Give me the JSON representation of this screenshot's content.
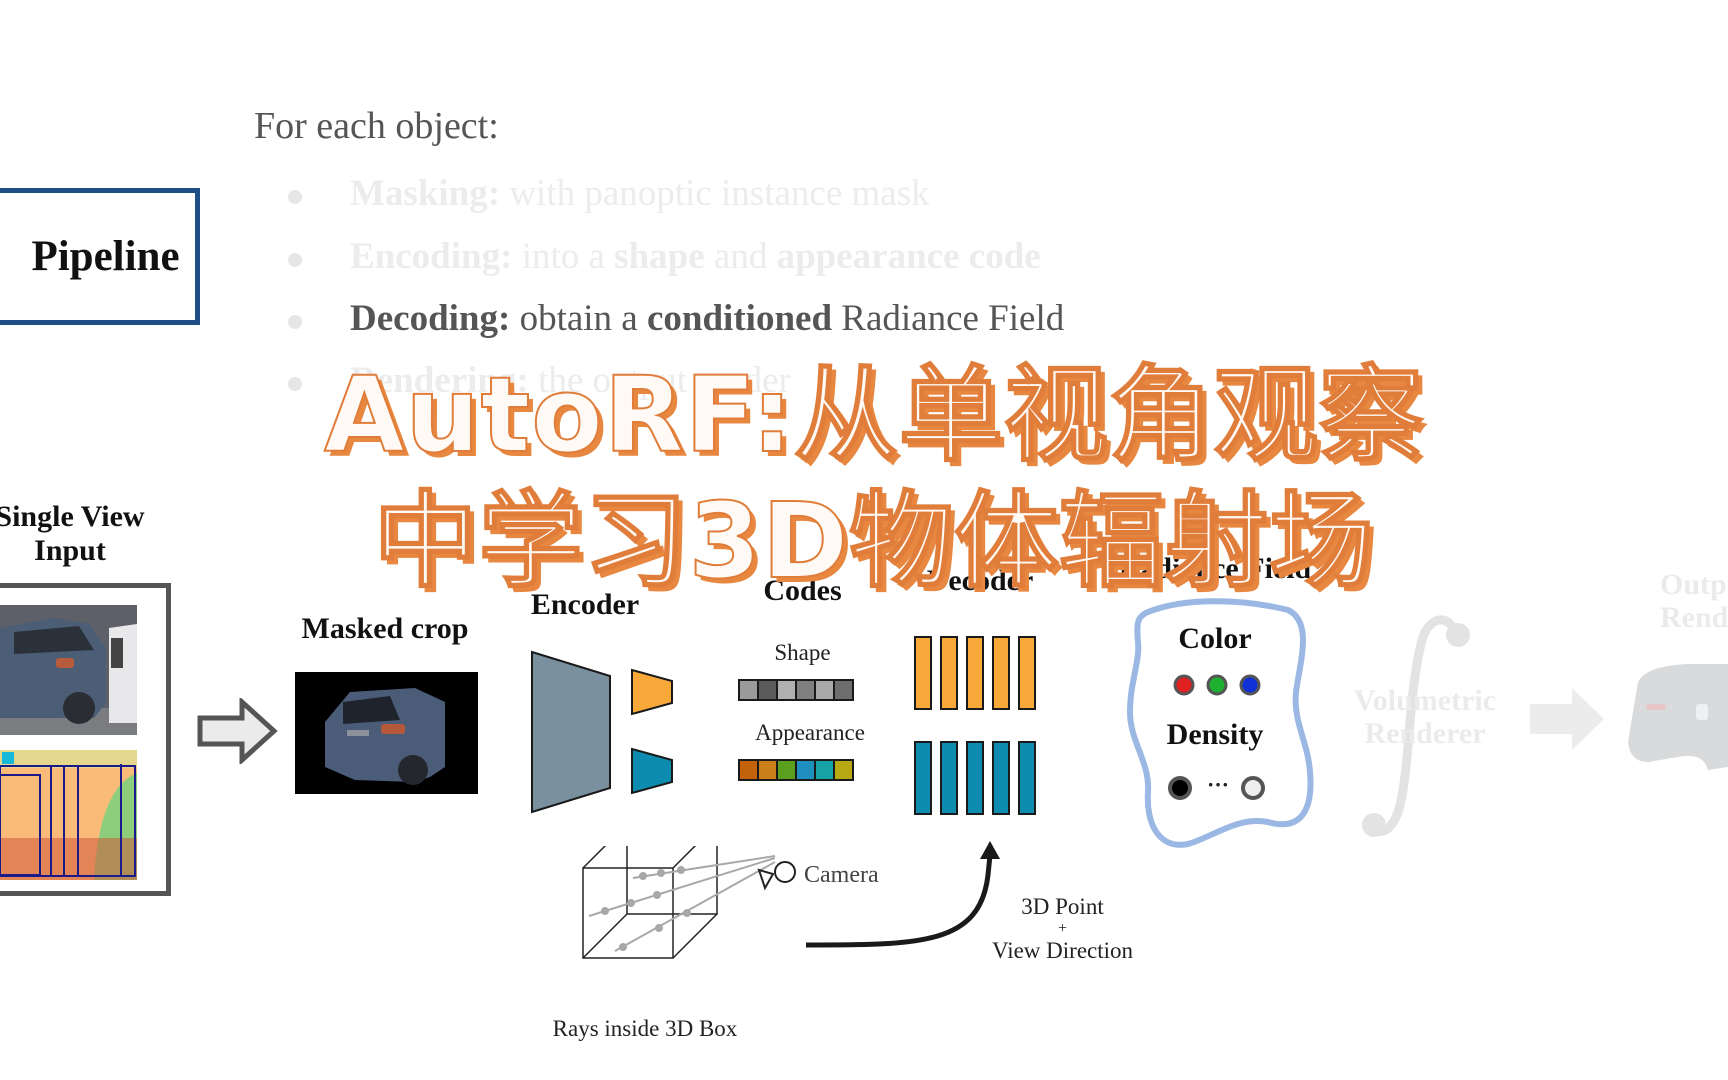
{
  "slide": {
    "intro": "For each object:",
    "section_label": "Pipeline",
    "bullets": [
      {
        "term": "Masking:",
        "rest": " with panoptic instance mask",
        "state": "faded"
      },
      {
        "term": "Encoding:",
        "parts": [
          " into a ",
          "shape",
          " and ",
          "appearance code"
        ],
        "state": "faded"
      },
      {
        "term": "Decoding:",
        "parts": [
          " obtain a ",
          "conditioned",
          " Radiance Field"
        ],
        "state": "active"
      },
      {
        "term": "Rendering:",
        "rest": " the output render",
        "state": "faded"
      }
    ]
  },
  "overlay_title": {
    "line1": "AutoRF:从单视角观察",
    "line2": "中学习3D物体辐射场",
    "color": "#e07d3a"
  },
  "diagram": {
    "input_label_line1": "Single View",
    "input_label_line2": "Input",
    "masked_crop_label": "Masked crop",
    "encoder_label": "Encoder",
    "codes_label": "Codes",
    "shape_label": "Shape",
    "appearance_label": "Appearance",
    "decoder_label": "Decoder",
    "radiance_field_label": "Radiance Field",
    "color_label": "Color",
    "density_label": "Density",
    "density_ellipsis": "···",
    "renderer_label_line1": "Volumetric",
    "renderer_label_line2": "Renderer",
    "output_label_line1": "Output",
    "output_label_line2": "Render",
    "camera_label": "Camera",
    "rays_label": "Rays inside 3D Box",
    "point_label_line1": "3D Point",
    "point_label_plus": "+",
    "point_label_line2": "View Direction",
    "shape_code_colors": [
      "#9a9a9a",
      "#5a5a5a",
      "#b0b0b0",
      "#808080",
      "#a8a8a8",
      "#6e6e6e"
    ],
    "appearance_code_colors": [
      "#c2620a",
      "#c9801a",
      "#5aa01e",
      "#1e8fbe",
      "#17a3a6",
      "#b8a814"
    ],
    "color_dots": [
      "#e02020",
      "#20b030",
      "#1030d8"
    ],
    "accent_orange": "#f9a93a",
    "accent_teal": "#0e8cb0",
    "encoder_gray": "#7a909f",
    "blob_blue": "#9bb8e4"
  }
}
